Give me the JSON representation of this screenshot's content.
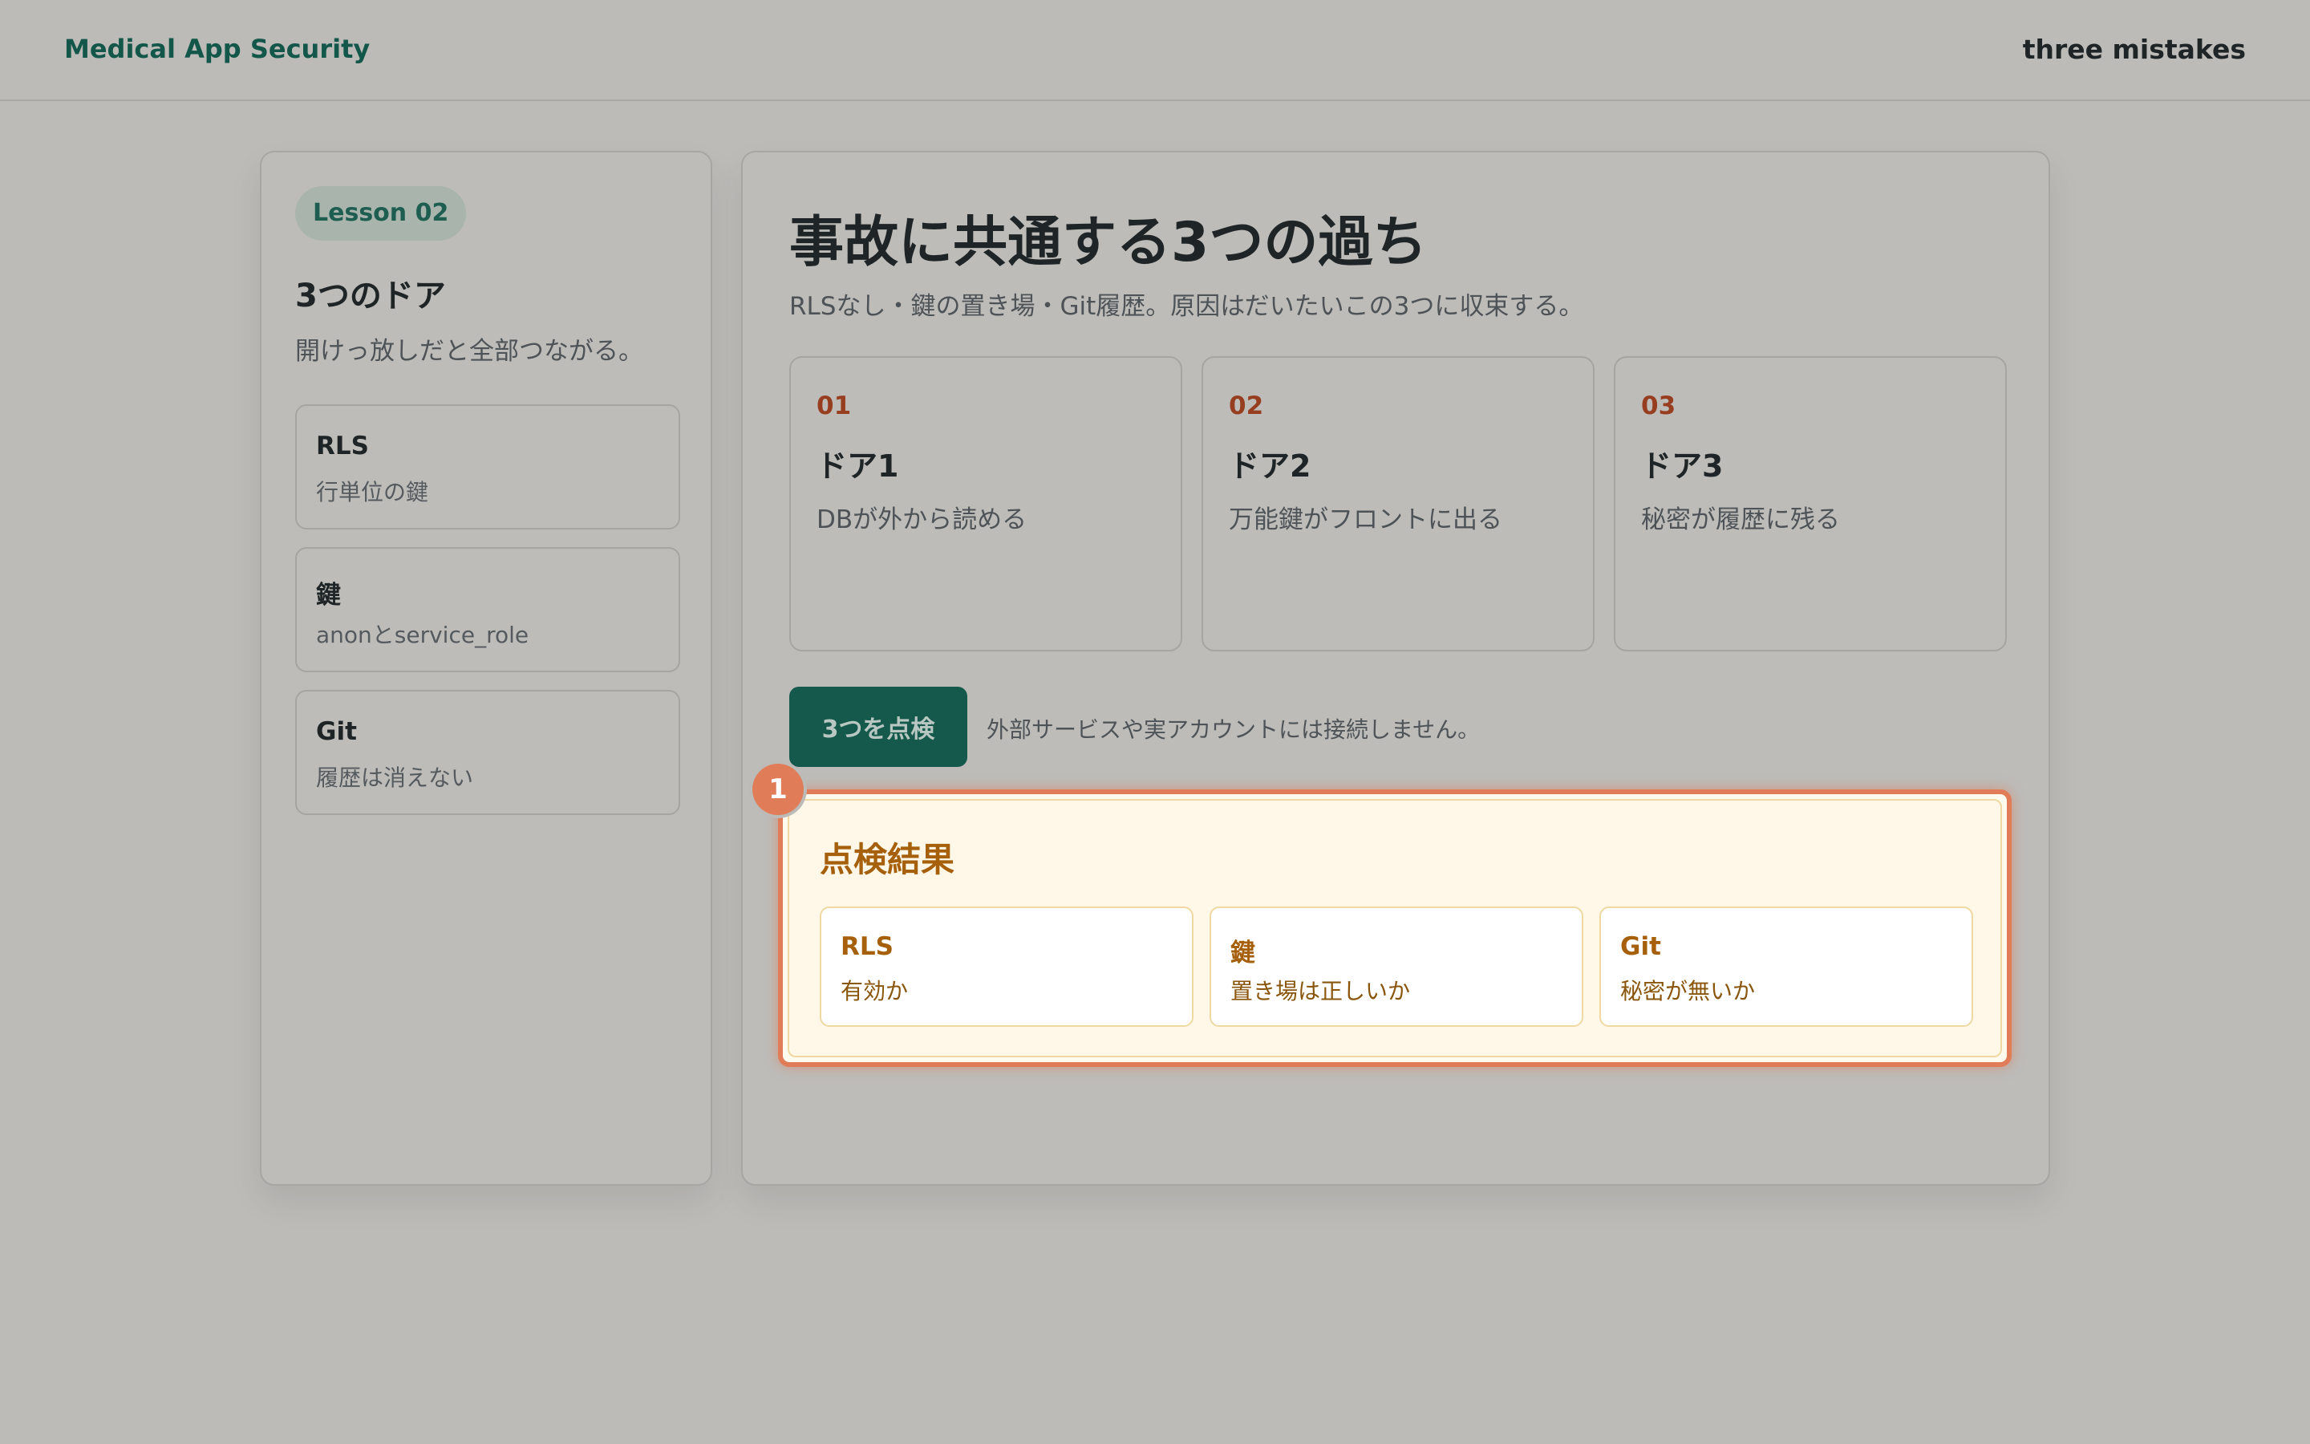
{
  "header": {
    "brand": "Medical App Security",
    "right_text": "three mistakes"
  },
  "sidebar": {
    "lesson": "Lesson 02",
    "title": "3つのドア",
    "subtitle": "開けっ放しだと全部つながる。",
    "cards": [
      {
        "title": "RLS",
        "desc": "行単位の鍵"
      },
      {
        "title": "鍵",
        "desc": "anonとservice_role"
      },
      {
        "title": "Git",
        "desc": "履歴は消えない"
      }
    ]
  },
  "main": {
    "title": "事故に共通する3つの過ち",
    "subtitle": "RLSなし・鍵の置き場・Git履歴。原因はだいたいこの3つに収束する。",
    "doors": [
      {
        "num": "01",
        "title": "ドア1",
        "desc": "DBが外から読める"
      },
      {
        "num": "02",
        "title": "ドア2",
        "desc": "万能鍵がフロントに出る"
      },
      {
        "num": "03",
        "title": "ドア3",
        "desc": "秘密が履歴に残る"
      }
    ],
    "check_button": "3つを点検",
    "note": "外部サービスや実アカウントには接続しません。"
  },
  "result": {
    "badge": "1",
    "title": "点検結果",
    "cards": [
      {
        "title": "RLS",
        "desc": "有効か"
      },
      {
        "title": "鍵",
        "desc": "置き場は正しいか"
      },
      {
        "title": "Git",
        "desc": "秘密が無いか"
      }
    ]
  },
  "colors": {
    "accent": "#14594c",
    "highlight": "#e07c58",
    "result_text": "#a65f0a",
    "door_number": "#963e1f"
  }
}
